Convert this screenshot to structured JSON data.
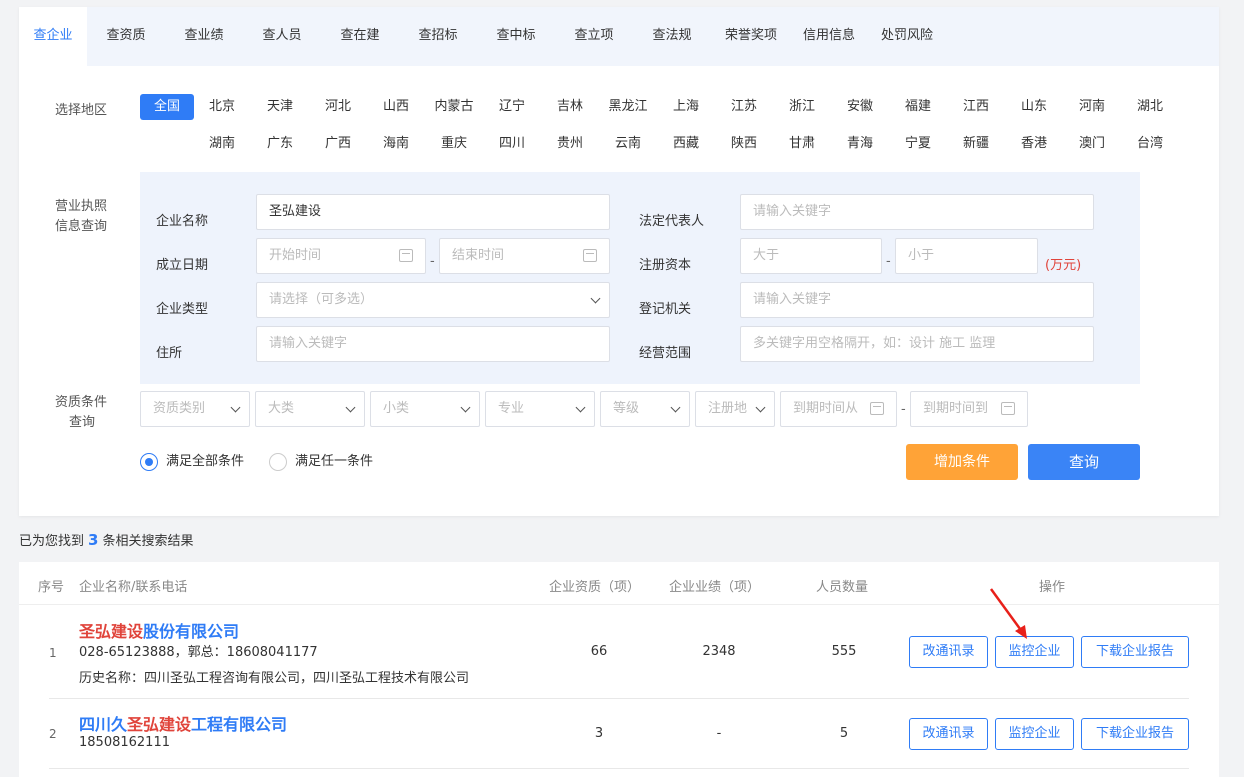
{
  "tabs": [
    "查企业",
    "查资质",
    "查业绩",
    "查人员",
    "查在建",
    "查招标",
    "查中标",
    "查立项",
    "查法规",
    "荣誉奖项",
    "信用信息",
    "处罚风险"
  ],
  "region_label": "选择地区",
  "regions_row1": [
    "全国",
    "北京",
    "天津",
    "河北",
    "山西",
    "内蒙古",
    "辽宁",
    "吉林",
    "黑龙江",
    "上海",
    "江苏",
    "浙江",
    "安徽",
    "福建",
    "江西",
    "山东",
    "河南",
    "湖北"
  ],
  "regions_row2": [
    "湖南",
    "广东",
    "广西",
    "海南",
    "重庆",
    "四川",
    "贵州",
    "云南",
    "西藏",
    "陕西",
    "甘肃",
    "青海",
    "宁夏",
    "新疆",
    "香港",
    "澳门",
    "台湾"
  ],
  "license_label": [
    "营业执照",
    "信息查询"
  ],
  "form": {
    "name_label": "企业名称",
    "name_value": "圣弘建设",
    "legal_label": "法定代表人",
    "legal_placeholder": "请输入关键字",
    "date_label": "成立日期",
    "date_start": "开始时间",
    "date_end": "结束时间",
    "capital_label": "注册资本",
    "capital_min": "大于",
    "capital_max": "小于",
    "capital_unit": "(万元)",
    "type_label": "企业类型",
    "type_placeholder": "请选择（可多选）",
    "authority_label": "登记机关",
    "authority_placeholder": "请输入关键字",
    "address_label": "住所",
    "address_placeholder": "请输入关键字",
    "scope_label": "经营范围",
    "scope_placeholder": "多关键字用空格隔开，如：设计 施工 监理",
    "dash": "-"
  },
  "qual_label": [
    "资质条件",
    "查询"
  ],
  "qual_selects": [
    "资质类别",
    "大类",
    "小类",
    "专业",
    "等级",
    "注册地"
  ],
  "qual_dates": [
    "到期时间从",
    "到期时间到"
  ],
  "radio_all": "满足全部条件",
  "radio_any": "满足任一条件",
  "btn_add": "增加条件",
  "btn_search": "查询",
  "result": {
    "prefix": "已为您找到",
    "count": "3",
    "suffix": "条相关搜索结果"
  },
  "table_headers": {
    "seq": "序号",
    "name": "企业名称/联系电话",
    "qual": "企业资质（项）",
    "perf": "企业业绩（项）",
    "staff": "人员数量",
    "ops": "操作"
  },
  "rows": [
    {
      "seq": "1",
      "name_hl": "圣弘建设",
      "name_rest": "股份有限公司",
      "phone": "028-65123888，郭总：18608041177",
      "history": "历史名称：四川圣弘工程咨询有限公司，四川圣弘工程技术有限公司",
      "qual": "66",
      "perf": "2348",
      "staff": "555"
    },
    {
      "seq": "2",
      "name_pre": "四川久",
      "name_hl": "圣弘建设",
      "name_rest": "工程有限公司",
      "phone": "18508162111",
      "qual": "3",
      "perf": "-",
      "staff": "5"
    }
  ],
  "ops": {
    "correct": "改通讯录",
    "monitor": "监控企业",
    "download": "下载企业报告"
  },
  "colors": {
    "accent": "#2f7cf6",
    "orange": "#ffa337",
    "highlight": "#e0443b"
  }
}
